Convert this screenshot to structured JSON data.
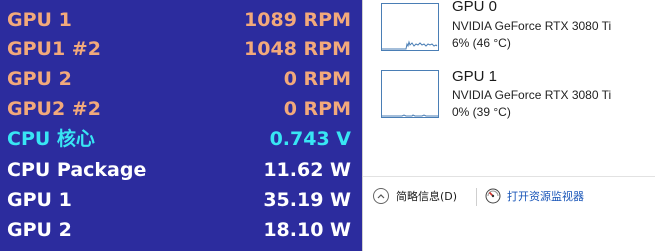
{
  "overlay": {
    "rows": [
      {
        "label": "GPU 1",
        "value": "1089 RPM",
        "color": "#f2a97b"
      },
      {
        "label": "GPU1 #2",
        "value": "1048 RPM",
        "color": "#f2a97b"
      },
      {
        "label": "GPU 2",
        "value": "0 RPM",
        "color": "#f2a97b"
      },
      {
        "label": "GPU2 #2",
        "value": "0 RPM",
        "color": "#f2a97b"
      },
      {
        "label": "CPU 核心",
        "value": "0.743 V",
        "color": "#38e6f4"
      },
      {
        "label": "CPU Package",
        "value": "11.62 W",
        "color": "#ffffff"
      },
      {
        "label": "GPU 1",
        "value": "35.19 W",
        "color": "#ffffff"
      },
      {
        "label": "GPU 2",
        "value": "18.10 W",
        "color": "#ffffff"
      }
    ]
  },
  "task_manager": {
    "gpus": [
      {
        "title": "GPU 0",
        "model": "NVIDIA GeForce RTX 3080 Ti",
        "usage": "6% (46 °C)"
      },
      {
        "title": "GPU 1",
        "model": "NVIDIA GeForce RTX 3080 Ti",
        "usage": "0% (39 °C)"
      }
    ],
    "footer": {
      "fewer_details": "简略信息(D)",
      "open_resource_monitor": "打开资源监视器"
    }
  }
}
